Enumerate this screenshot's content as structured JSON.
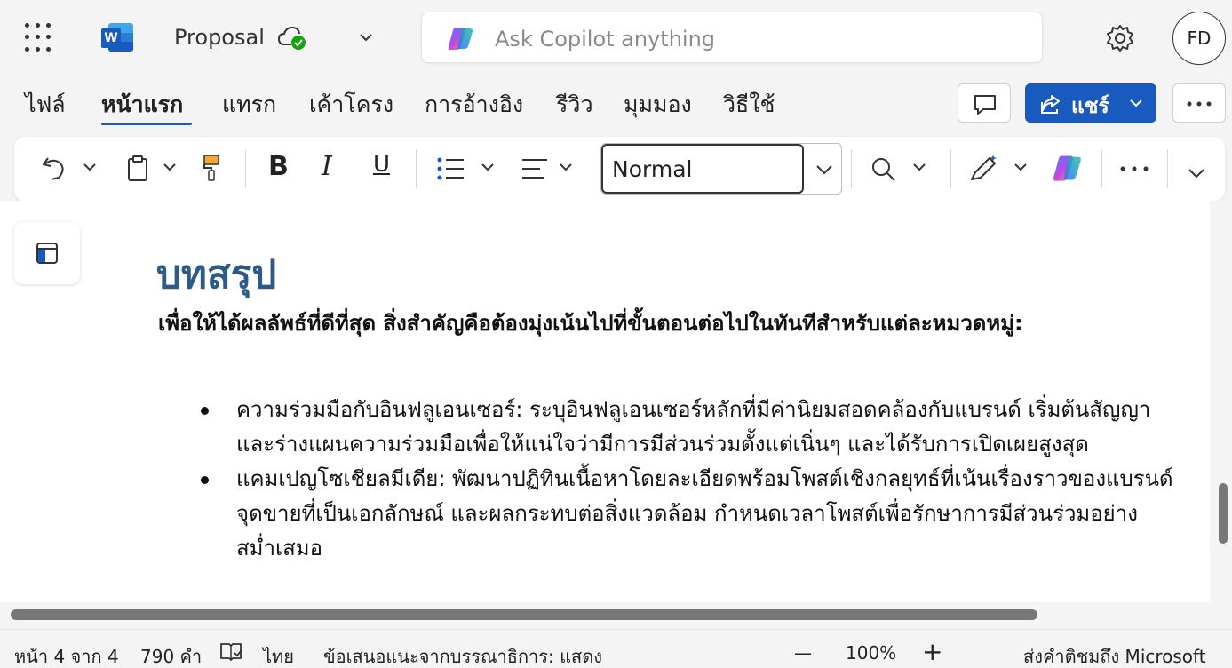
{
  "titlebar": {
    "doc_title": "Proposal",
    "copilot_placeholder": "Ask Copilot anything",
    "avatar_initials": "FD"
  },
  "ribbon": {
    "tabs": [
      "ไฟล์",
      "หน้าแรก",
      "แทรก",
      "เค้าโครง",
      "การอ้างอิง",
      "รีวิว",
      "มุมมอง",
      "วิธีใช้"
    ],
    "active_tab": "หน้าแรก",
    "share_label": "แชร์"
  },
  "toolbar": {
    "style_value": "Normal"
  },
  "document": {
    "heading": "บทสรุป",
    "paragraph": "เพื่อให้ได้ผลลัพธ์ที่ดีที่สุด สิ่งสำคัญคือต้องมุ่งเน้นไปที่ขั้นตอนต่อไปในทันทีสำหรับแต่ละหมวดหมู่:",
    "bullets": [
      "ความร่วมมือกับอินฟลูเอนเซอร์: ระบุอินฟลูเอนเซอร์หลักที่มีค่านิยมสอดคล้องกับแบรนด์ เริ่มต้นสัญญาและร่างแผนความร่วมมือเพื่อให้แน่ใจว่ามีการมีส่วนร่วมตั้งแต่เนิ่นๆ และได้รับการเปิดเผยสูงสุด",
      "แคมเปญโซเชียลมีเดีย: พัฒนาปฏิทินเนื้อหาโดยละเอียดพร้อมโพสต์เชิงกลยุทธ์ที่เน้นเรื่องราวของแบรนด์ จุดขายที่เป็นเอกลักษณ์ และผลกระทบต่อสิ่งแวดล้อม กำหนดเวลาโพสต์เพื่อรักษาการมีส่วนร่วมอย่างสม่ำเสมอ"
    ]
  },
  "statusbar": {
    "page_info": "หน้า 4 จาก 4",
    "word_count": "790 คำ",
    "language": "ไทย",
    "editor_suggestions": "ข้อเสนอแนะจากบรรณาธิการ: แสดง",
    "zoom_minus": "—",
    "zoom": "100%",
    "zoom_plus": "+",
    "feedback": "ส่งคำติชมถึง Microsoft"
  },
  "colors": {
    "accent": "#185abd",
    "heading": "#2e5a88"
  }
}
